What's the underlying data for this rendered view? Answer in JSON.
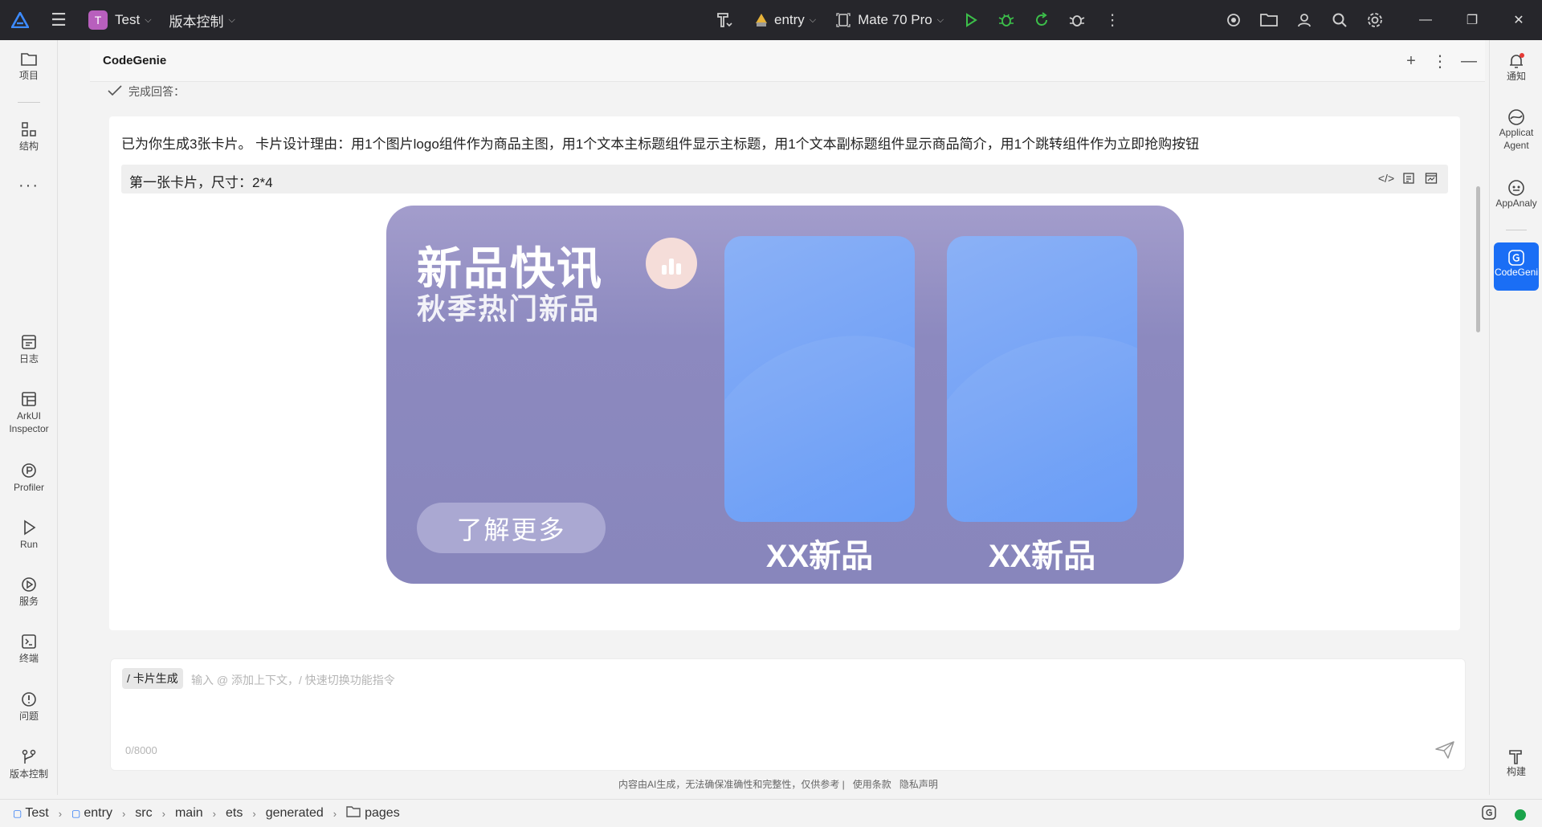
{
  "titlebar": {
    "project_badge": "T",
    "project_name": "Test",
    "vcs_menu": "版本控制",
    "module": "entry",
    "device": "Mate 70 Pro"
  },
  "left_sidebar": {
    "items": [
      {
        "label": "项目",
        "icon": "folder-icon"
      },
      {
        "label": "结构",
        "icon": "structure-icon"
      },
      {
        "label": "日志",
        "icon": "log-icon"
      },
      {
        "label": "ArkUI Inspector",
        "icon": "inspector-icon"
      },
      {
        "label": "Profiler",
        "icon": "profiler-icon"
      },
      {
        "label": "Run",
        "icon": "run-icon"
      },
      {
        "label": "服务",
        "icon": "service-icon"
      },
      {
        "label": "终端",
        "icon": "terminal-icon"
      },
      {
        "label": "问题",
        "icon": "problem-icon"
      },
      {
        "label": "版本控制",
        "icon": "vcs-icon"
      }
    ]
  },
  "right_sidebar": {
    "items": [
      {
        "label": "通知"
      },
      {
        "label": "Applicat Agent"
      },
      {
        "label": "AppAnaly"
      },
      {
        "label": "CodeGeni"
      },
      {
        "label": "构建"
      }
    ]
  },
  "panel": {
    "title": "CodeGenie",
    "done_label": "完成回答："
  },
  "answer": {
    "text": "已为你生成3张卡片。 卡片设计理由：用1个图片logo组件作为商品主图，用1个文本主标题组件显示主标题，用1个文本副标题组件显示商品简介，用1个跳转组件作为立即抢购按钮",
    "card_header": "第一张卡片，尺寸：2*4"
  },
  "preview_card": {
    "title": "新品快讯",
    "subtitle": "秋季热门新品",
    "button": "了解更多",
    "products": [
      {
        "label": "XX新品"
      },
      {
        "label": "XX新品"
      }
    ],
    "colors": {
      "card_bg": "#8c89bf",
      "product_bg": "#78a5f6",
      "logo_bg": "#f5ddd9"
    }
  },
  "input": {
    "command_chip": "/ 卡片生成",
    "placeholder": "输入 @ 添加上下文，/ 快速切换功能指令",
    "char_count": "0/8000"
  },
  "disclaimer": {
    "text": "内容由AI生成，无法确保准确性和完整性，仅供参考 |",
    "terms": "使用条款",
    "privacy": "隐私声明"
  },
  "breadcrumb": [
    "Test",
    "entry",
    "src",
    "main",
    "ets",
    "generated",
    "pages"
  ]
}
